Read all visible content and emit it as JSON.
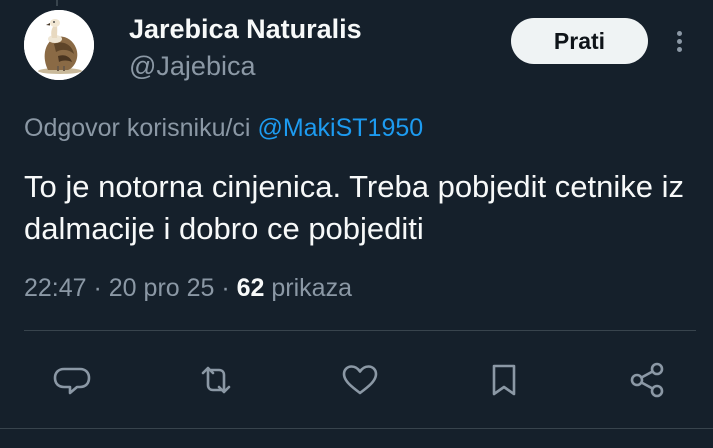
{
  "tweet": {
    "author_name": "Jarebica Naturalis",
    "author_handle": "@Jajebica",
    "follow_label": "Prati",
    "reply_prefix": "Odgovor korisniku/ci ",
    "reply_mention": "@MakiST1950",
    "text": "To je notorna cinjenica. Treba pobjedit cetnike iz dalmacije i dobro ce pobjediti",
    "time": "22:47",
    "separator": " · ",
    "date": "20 pro 25",
    "views_count": "62",
    "views_label": " prikaza"
  },
  "icons": {
    "avatar": "vulture-illustration",
    "more": "more-vertical-icon",
    "actions": [
      "reply-icon",
      "retweet-icon",
      "like-icon",
      "bookmark-icon",
      "share-icon"
    ]
  },
  "colors": {
    "background": "#15202b",
    "text_primary": "#f7f9f9",
    "text_secondary": "#8b98a5",
    "link": "#1d9bf0",
    "divider": "#38444d",
    "follow_button_bg": "#eff3f4"
  }
}
